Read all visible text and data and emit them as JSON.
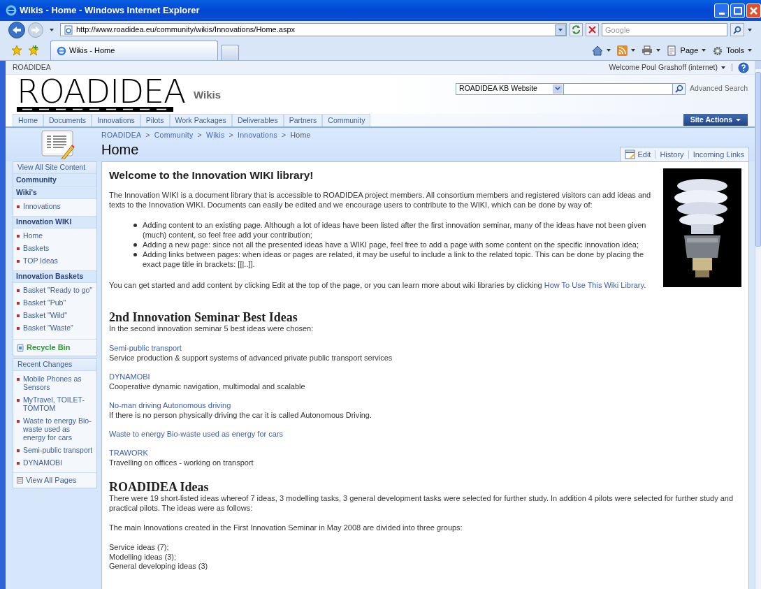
{
  "browser": {
    "title": "Wikis - Home - Windows Internet Explorer",
    "address": "http://www.roadidea.eu/community/wikis/Innovations/Home.aspx",
    "search_placeholder": "Google",
    "tabs": [
      {
        "label": "Wikis - Home",
        "selected": true
      }
    ],
    "commands": [
      "Page",
      "Tools"
    ]
  },
  "site": {
    "name": "ROADIDEA",
    "welcome": "Welcome Poul Grashoff (internet)",
    "logo": "ROADIDEA",
    "site_title": "Wikis",
    "search_scope": "ROADIDEA KB Website",
    "advanced_search": "Advanced Search",
    "site_actions": "Site Actions",
    "nav": [
      {
        "label": "Home",
        "selected": false
      },
      {
        "label": "Documents",
        "selected": false
      },
      {
        "label": "Innovations",
        "selected": false
      },
      {
        "label": "Pilots",
        "selected": false
      },
      {
        "label": "Work Packages",
        "selected": false
      },
      {
        "label": "Deliverables",
        "selected": false
      },
      {
        "label": "Partners",
        "selected": false
      },
      {
        "label": "Community",
        "selected": false
      }
    ]
  },
  "breadcrumb": {
    "separator": ">",
    "items": [
      "ROADIDEA",
      "Community",
      "Wikis",
      "Innovations",
      "Home"
    ]
  },
  "page_title": "Home",
  "page_actions": [
    "Edit",
    "History",
    "Incoming Links"
  ],
  "sidebar": [
    {
      "items": [
        {
          "kind": "top",
          "label": "View All Site Content"
        },
        {
          "kind": "heading",
          "label": "Community"
        },
        {
          "kind": "heading",
          "label": "Wiki's"
        },
        {
          "kind": "item",
          "label": "Innovations"
        },
        {
          "kind": "heading",
          "label": "Innovation WIKI"
        },
        {
          "kind": "item",
          "label": "Home"
        },
        {
          "kind": "item",
          "label": "Baskets"
        },
        {
          "kind": "item",
          "label": "TOP Ideas"
        },
        {
          "kind": "heading",
          "label": "Innovation Baskets"
        },
        {
          "kind": "item",
          "label": "Basket \"Ready to go\""
        },
        {
          "kind": "item",
          "label": "Basket \"Pub\""
        },
        {
          "kind": "item",
          "label": "Basket \"Wild\""
        },
        {
          "kind": "item",
          "label": "Basket \"Waste\""
        },
        {
          "kind": "recycle",
          "label": "Recycle Bin"
        }
      ]
    },
    {
      "items": [
        {
          "kind": "top",
          "label": "Recent Changes"
        },
        {
          "kind": "item",
          "label": "Mobile Phones as Sensors"
        },
        {
          "kind": "item",
          "label": "MyTravel, TOILET-TOMTOM"
        },
        {
          "kind": "item",
          "label": "Waste to energy Bio-waste used as energy for cars"
        },
        {
          "kind": "item",
          "label": "Semi-public transport"
        },
        {
          "kind": "item",
          "label": "DYNAMOBI"
        },
        {
          "kind": "view_all",
          "label": "View All Pages"
        }
      ]
    }
  ],
  "content": [
    {
      "kind": "title",
      "text": "Welcome to the Innovation WIKI library!"
    },
    {
      "kind": "paragraph",
      "text": "The Innovation WIKI is a document library that is accessible to ROADIDEA project members. All consortium members and registered visitors can add ideas and texts to the Innovation WIKI. Documents can easily be edited and we encourage users to contribute to the WIKI, which can be done by way of:"
    },
    {
      "kind": "bullets",
      "items": [
        "Adding content to an existing page. Although a lot of ideas have been listed after the first innovation seminar, many of the ideas have not been given (much) content, so feel free add your contribution;",
        "Adding a new page: since not all the presented ideas have a WIKI page, feel free to add a page with some content on the specific innovation idea;",
        "Adding links between pages: when ideas or pages are related, it may be useful to include a link to the related topic. This can be done by placing the exact page title in brackets: [[|..]]."
      ]
    },
    {
      "kind": "link_sentence",
      "text": "You can get started and add content by clicking Edit at the top of the page, or you can learn more about wiki libraries by clicking ",
      "link": "How To Use This Wiki Library",
      "end": "."
    },
    {
      "kind": "heading",
      "text": "2nd Innovation Seminar Best Ideas"
    },
    {
      "kind": "line",
      "text": "In the second innovation seminar 5 best ideas were chosen:"
    },
    {
      "kind": "idea",
      "link": "Semi-public transport",
      "text": "Service production & support systems of advanced private public transport services"
    },
    {
      "kind": "idea",
      "link": "DYNAMOBI",
      "text": "Cooperative dynamic navigation, multimodal and scalable"
    },
    {
      "kind": "idea",
      "link": "No-man driving Autonomous driving",
      "text": "If there is no person physically driving the car it is called Autonomous Driving."
    },
    {
      "kind": "idea",
      "link": "Waste to energy Bio-waste used as energy for cars"
    },
    {
      "kind": "idea",
      "link": "TRAWORK",
      "text": "Travelling on offices - working on transport"
    },
    {
      "kind": "heading",
      "text": "ROADIDEA Ideas"
    },
    {
      "kind": "line",
      "text": "There were 19 short-listed ideas whereof 7 ideas, 3 modelling tasks, 3 general development tasks were selected for further study. In addition 4 pilots were selected for further study and practical pilots. The ideas were as follows:"
    },
    {
      "kind": "paragraph",
      "text": "The main Innovations created in the First Innovation Seminar in May 2008 are divided into three groups:"
    },
    {
      "kind": "lines",
      "items": [
        "Service ideas (7);",
        "Modelling ideas (3);",
        "General developing ideas (3)"
      ]
    }
  ]
}
